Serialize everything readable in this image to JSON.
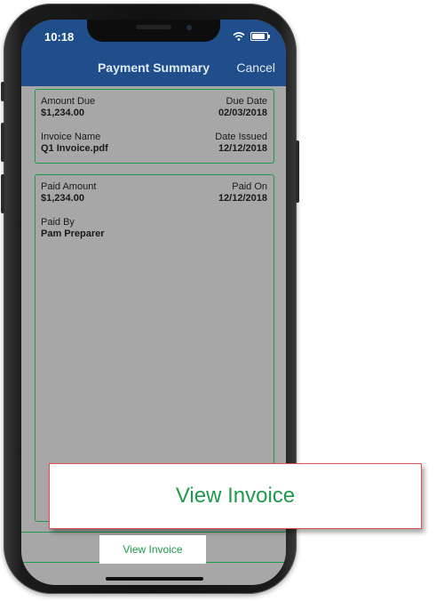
{
  "status_bar": {
    "time": "10:18",
    "wifi_icon": "wifi-icon",
    "battery_icon": "battery-icon"
  },
  "nav": {
    "title": "Payment Summary",
    "cancel_label": "Cancel"
  },
  "invoice_card": {
    "amount_due_label": "Amount Due",
    "amount_due_value": "$1,234.00",
    "due_date_label": "Due Date",
    "due_date_value": "02/03/2018",
    "invoice_name_label": "Invoice Name",
    "invoice_name_value": "Q1 Invoice.pdf",
    "date_issued_label": "Date Issued",
    "date_issued_value": "12/12/2018"
  },
  "payment_card": {
    "paid_amount_label": "Paid Amount",
    "paid_amount_value": "$1,234.00",
    "paid_on_label": "Paid On",
    "paid_on_value": "12/12/2018",
    "paid_by_label": "Paid By",
    "paid_by_value": "Pam Preparer"
  },
  "actions": {
    "view_invoice_label": "View Invoice"
  },
  "callout": {
    "label": "View Invoice"
  },
  "colors": {
    "nav_blue": "#1f4e8a",
    "accent_green": "#1f9a4c",
    "screen_gray": "#a7a7a7",
    "callout_border": "#e05050"
  }
}
